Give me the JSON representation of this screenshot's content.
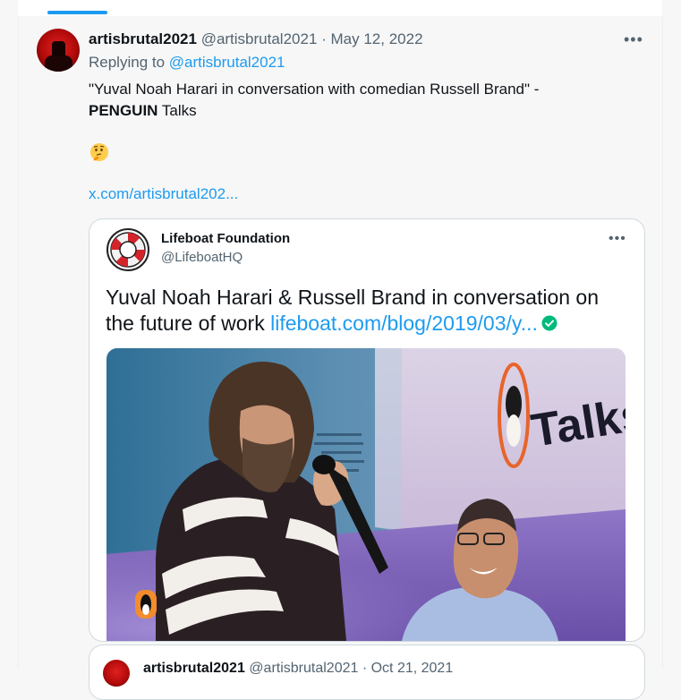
{
  "tweet": {
    "display_name": "artisbrutal2021",
    "handle": "@artisbrutal2021",
    "separator": " · ",
    "date": "May 12, 2022",
    "more_label": "•••",
    "reply_prefix": "Replying to ",
    "reply_handle": "@artisbrutal2021",
    "text_line1": "\"Yuval Noah Harari in conversation with comedian Russell Brand\" -",
    "text_bold": "PENGUIN",
    "text_after_bold": " Talks",
    "emoji": "thinking-face-emoji",
    "link": "x.com/artisbrutal202..."
  },
  "quote": {
    "name": "Lifeboat Foundation",
    "handle": "@LifeboatHQ",
    "more_label": "•••",
    "text": "Yuval Noah Harari & Russell Brand in conversation on the future of work ",
    "link": "lifeboat.com/blog/2019/03/y...",
    "check_icon": "green-check-icon",
    "image_caption_text": "Talks"
  },
  "next_quote": {
    "display_name": "artisbrutal2021",
    "handle": "@artisbrutal2021",
    "separator": " · ",
    "date": "Oct 21, 2021"
  },
  "colors": {
    "accent": "#1d9bf0",
    "secondary_text": "#536471",
    "primary_text": "#0f1419",
    "border": "#cfd9de",
    "check": "#00ba7c"
  }
}
